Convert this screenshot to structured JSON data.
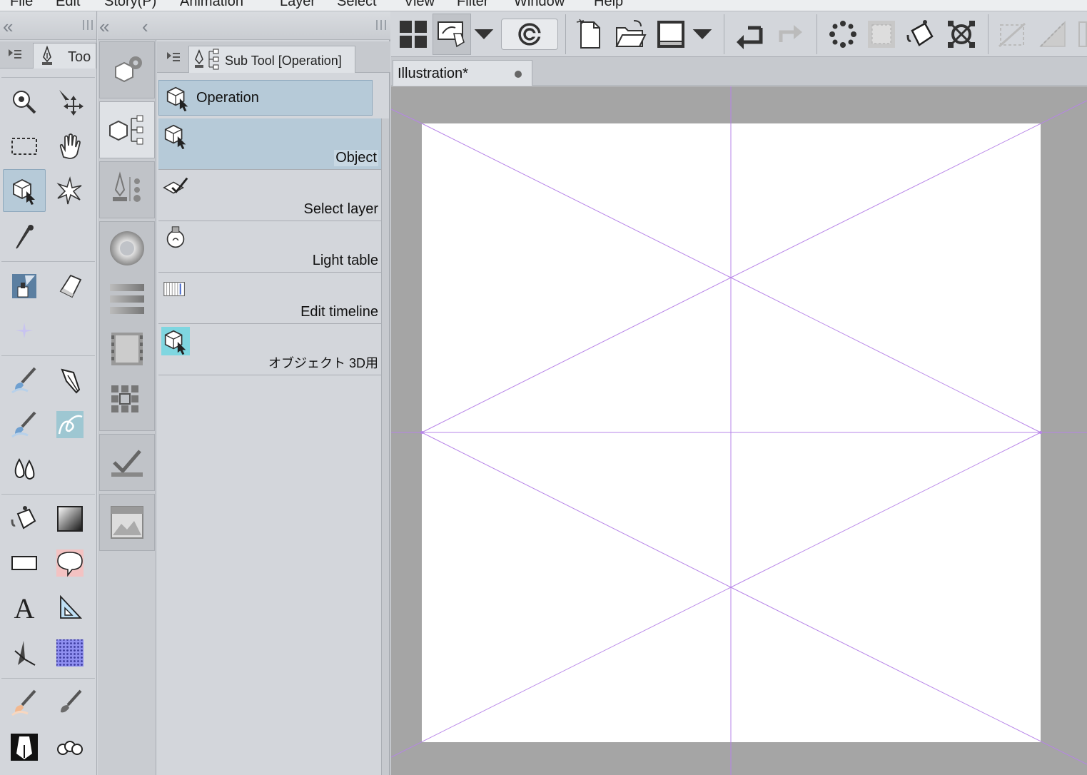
{
  "menubar": {
    "items": [
      "File",
      "Edit",
      "Story(P)",
      "Animation",
      "Layer",
      "Select",
      "View",
      "Filter",
      "Window",
      "Help"
    ]
  },
  "tool_palette": {
    "tab_label": "Too",
    "tools": [
      {
        "name": "zoom-icon",
        "group": 1
      },
      {
        "name": "move-icon",
        "group": 1
      },
      {
        "name": "selection-rect-icon",
        "group": 1
      },
      {
        "name": "hand-icon",
        "group": 1
      },
      {
        "name": "operation-icon",
        "group": 1,
        "active": true
      },
      {
        "name": "auto-select-icon",
        "group": 1
      },
      {
        "name": "eyedropper-icon",
        "group": 1
      }
    ]
  },
  "subtool_panel": {
    "tab_label": "Sub Tool [Operation]",
    "group_label": "Operation",
    "items": [
      {
        "label": "Object",
        "active": true
      },
      {
        "label": "Select layer",
        "active": false
      },
      {
        "label": "Light table",
        "active": false
      },
      {
        "label": "Edit timeline",
        "active": false
      },
      {
        "label": "オブジェクト 3D用",
        "active": false
      }
    ]
  },
  "canvas": {
    "tab_title": "Illustration*",
    "background": "#a5a5a5",
    "paper": "#ffffff",
    "guide_color": "#b784e8"
  },
  "colors": {
    "panel": "#d3d6db",
    "active": "#b6cad8",
    "accent_cyan": "#7fd6e0"
  }
}
